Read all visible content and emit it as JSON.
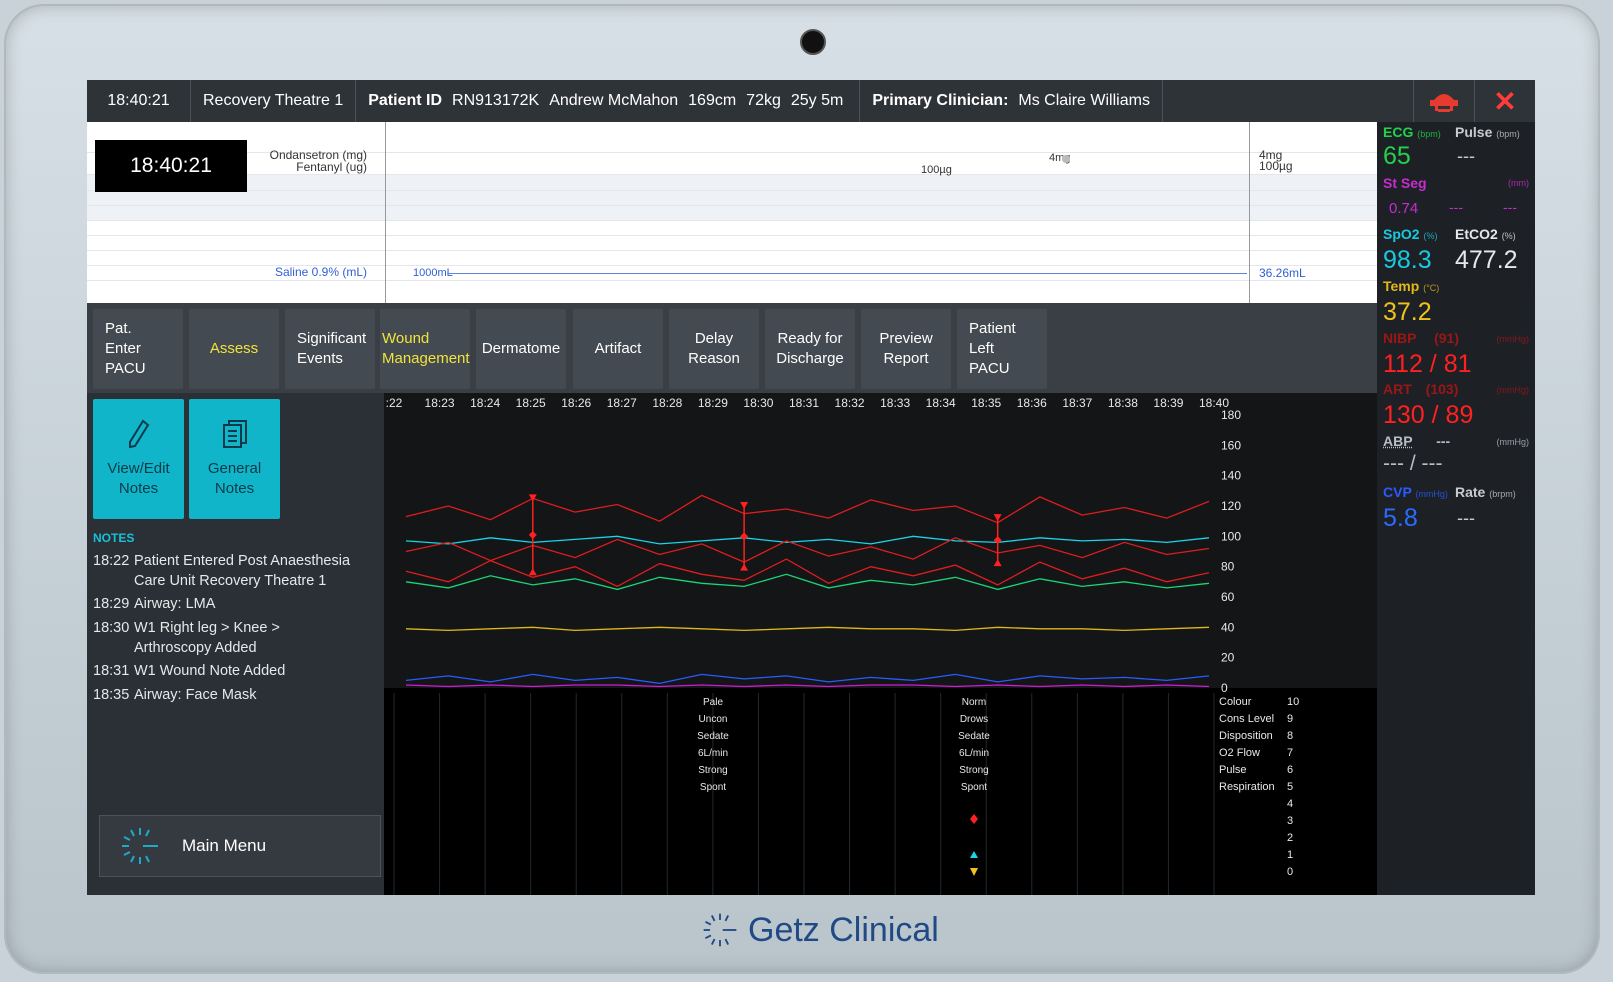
{
  "header": {
    "time": "18:40:21",
    "location": "Recovery Theatre 1",
    "patient_id_label": "Patient ID",
    "patient_id": "RN913172K",
    "patient_name": "Andrew McMahon",
    "height": "169cm",
    "weight": "72kg",
    "age": "25y 5m",
    "clinician_label": "Primary Clinician:",
    "clinician": "Ms Claire Williams"
  },
  "drugs": {
    "clock": "18:40:21",
    "drug1": "Ondansetron (mg)",
    "drug2": "Fentanyl (ug)",
    "fluid": "Saline 0.9% (mL)",
    "dose_fentanyl": "100µg",
    "dose_ondansetron": "4mg",
    "total_ondansetron": "4mg",
    "total_fentanyl": "100µg",
    "fluid_start": "1000mL",
    "fluid_total": "36.26mL"
  },
  "buttons": [
    {
      "l1": "Pat. Enter",
      "l2": "PACU"
    },
    {
      "l1": "Assess",
      "l2": ""
    },
    {
      "l1": "Significant",
      "l2": "Events"
    },
    {
      "l1": "Wound",
      "l2": "Management"
    },
    {
      "l1": "Dermatome",
      "l2": ""
    },
    {
      "l1": "Artifact",
      "l2": ""
    },
    {
      "l1": "Delay",
      "l2": "Reason"
    },
    {
      "l1": "Ready for",
      "l2": "Discharge"
    },
    {
      "l1": "Preview",
      "l2": "Report"
    },
    {
      "l1": "Patient Left",
      "l2": "PACU"
    }
  ],
  "note_buttons": {
    "view_edit_1": "View/Edit",
    "view_edit_2": "Notes",
    "general_1": "General",
    "general_2": "Notes"
  },
  "notes": {
    "title": "NOTES",
    "items": [
      {
        "time": "18:22",
        "line1": "Patient Entered Post Anaesthesia",
        "line2": "Care Unit Recovery Theatre 1"
      },
      {
        "time": "18:29",
        "line1": "Airway: LMA",
        "line2": ""
      },
      {
        "time": "18:30",
        "line1": "W1 Right leg > Knee >",
        "line2": "Arthroscopy Added"
      },
      {
        "time": "18:31",
        "line1": "W1 Wound Note Added",
        "line2": ""
      },
      {
        "time": "18:35",
        "line1": "Airway: Face Mask",
        "line2": ""
      }
    ]
  },
  "main_menu": "Main Menu",
  "chart_data": {
    "type": "line",
    "x_ticks": [
      ":22",
      "18:23",
      "18:24",
      "18:25",
      "18:26",
      "18:27",
      "18:28",
      "18:29",
      "18:30",
      "18:31",
      "18:32",
      "18:33",
      "18:34",
      "18:35",
      "18:36",
      "18:37",
      "18:38",
      "18:39",
      "18:40"
    ],
    "y_ticks": [
      180,
      160,
      140,
      120,
      100,
      80,
      60,
      40,
      20,
      0
    ],
    "ylim": [
      0,
      180
    ],
    "series": [
      {
        "color": "#e01d1d",
        "values": [
          113,
          120,
          111,
          125,
          116,
          121,
          110,
          127,
          115,
          118,
          112,
          124,
          117,
          120,
          109,
          126,
          114,
          119,
          112,
          123
        ]
      },
      {
        "color": "#19d6e6",
        "values": [
          97,
          95,
          99,
          96,
          98,
          100,
          95,
          97,
          99,
          96,
          98,
          95,
          100,
          97,
          96,
          99,
          97,
          98,
          96,
          99
        ]
      },
      {
        "color": "#e01d1d",
        "values": [
          90,
          96,
          84,
          94,
          86,
          98,
          88,
          95,
          83,
          97,
          87,
          93,
          85,
          99,
          89,
          94,
          86,
          96,
          88,
          92
        ]
      },
      {
        "color": "#e01d1d",
        "values": [
          77,
          70,
          84,
          73,
          80,
          67,
          82,
          75,
          71,
          85,
          69,
          80,
          74,
          81,
          68,
          83,
          72,
          79,
          70,
          76
        ]
      },
      {
        "color": "#19d676",
        "values": [
          70,
          66,
          74,
          68,
          72,
          65,
          73,
          69,
          67,
          75,
          66,
          71,
          68,
          73,
          65,
          72,
          67,
          70,
          66,
          69
        ]
      },
      {
        "color": "#e0b81a",
        "values": [
          39,
          38,
          39,
          40,
          38,
          39,
          40,
          39,
          38,
          39,
          40,
          39,
          39,
          38,
          40,
          39,
          39,
          38,
          39,
          40
        ]
      },
      {
        "color": "#2a5bff",
        "values": [
          5,
          8,
          4,
          9,
          5,
          7,
          3,
          9,
          6,
          8,
          4,
          7,
          5,
          9,
          4,
          8,
          6,
          7,
          5,
          8
        ]
      },
      {
        "color": "#d21ad6",
        "values": [
          2,
          1,
          2,
          1,
          2,
          2,
          1,
          2,
          1,
          2,
          1,
          2,
          2,
          1,
          2,
          1,
          2,
          1,
          2,
          1
        ]
      }
    ],
    "bp_marks": [
      {
        "index": 3,
        "sys": 125,
        "dia": 77
      },
      {
        "index": 8,
        "sys": 120,
        "dia": 80
      },
      {
        "index": 14,
        "sys": 112,
        "dia": 83
      }
    ],
    "score_labels": [
      "Colour",
      "Cons Level",
      "Disposition",
      "O2 Flow",
      "Pulse",
      "Respiration"
    ],
    "score_scale": [
      "10",
      "9",
      "8",
      "7",
      "6",
      "5",
      "4",
      "3",
      "2",
      "1",
      "0"
    ],
    "score_col1": [
      "Pale",
      "Uncon",
      "Sedate",
      "6L/min",
      "Strong",
      "Spont"
    ],
    "score_col2": [
      "Norm",
      "Drows",
      "Sedate",
      "6L/min",
      "Strong",
      "Spont"
    ]
  },
  "vitals": {
    "ecg_label": "ECG",
    "ecg_unit": "(bpm)",
    "ecg": "65",
    "pulse_label": "Pulse",
    "pulse_unit": "(bpm)",
    "pulse": "---",
    "stseg_label": "St Seg",
    "stseg_unit": "(mm)",
    "stseg": "0.74",
    "stseg2": "---",
    "stseg3": "---",
    "spo2_label": "SpO2",
    "spo2_unit": "(%)",
    "spo2": "98.3",
    "etco2_label": "EtCO2",
    "etco2_unit": "(%)",
    "etco2": "477.2",
    "temp_label": "Temp",
    "temp_unit": "(°C)",
    "temp": "37.2",
    "nibp_label": "NIBP",
    "nibp_mean": "(91)",
    "nibp_unit": "(mmHg)",
    "nibp": "112 / 81",
    "art_label": "ART",
    "art_mean": "(103)",
    "art_unit": "(mmHg)",
    "art": "130 / 89",
    "abp_label": "ABP",
    "abp_mean": "---",
    "abp_unit": "(mmHg)",
    "abp": "--- / ---",
    "cvp_label": "CVP",
    "cvp_unit": "(mmHg)",
    "cvp": "5.8",
    "rate_label": "Rate",
    "rate_unit": "(brpm)",
    "rate": "---"
  },
  "brand": "Getz Clinical"
}
